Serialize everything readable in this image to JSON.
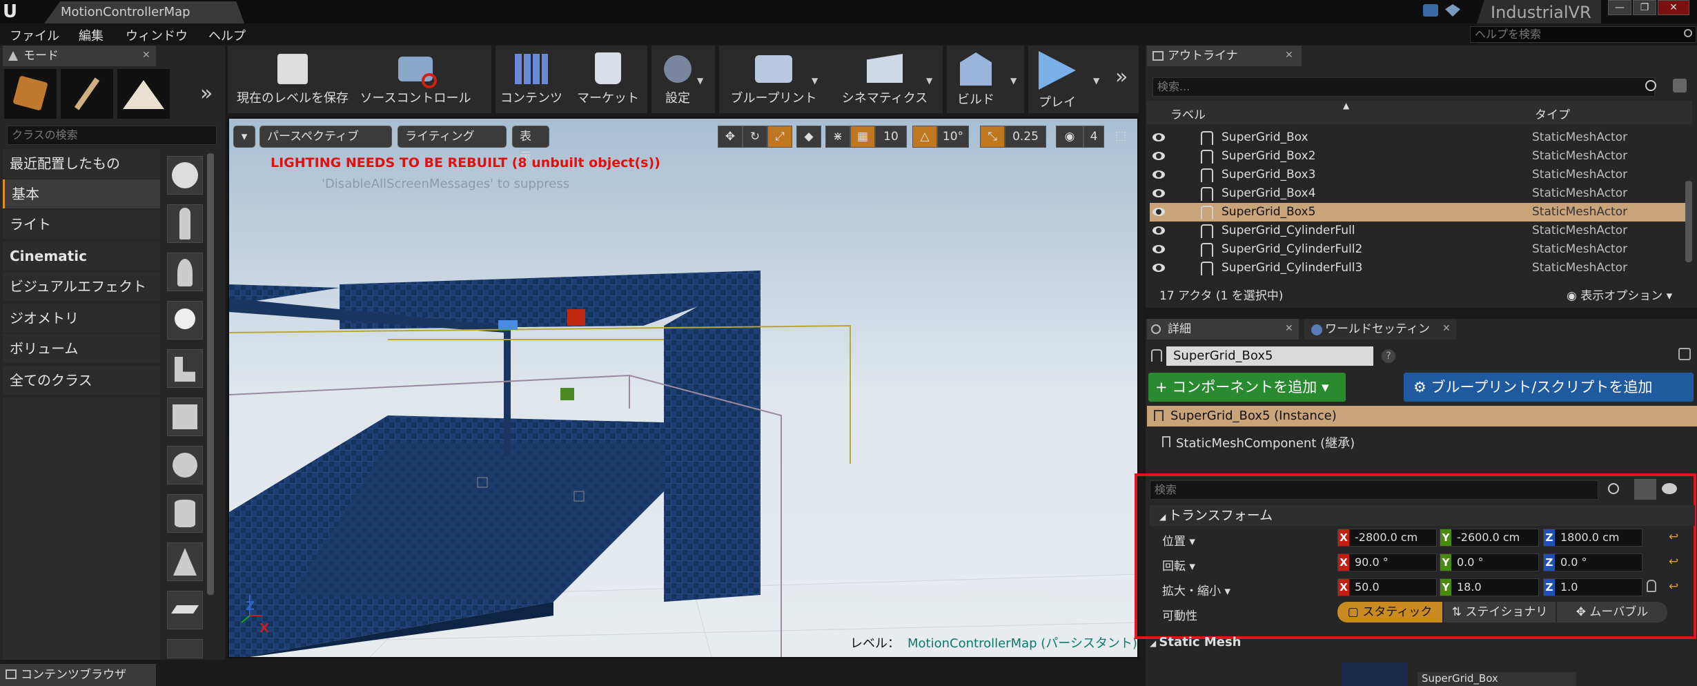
{
  "app": {
    "logo": "U",
    "tab_title": "MotionControllerMap",
    "project_name": "IndustrialVR",
    "help_search_placeholder": "ヘルプを検索",
    "window_buttons": {
      "minimize": "—",
      "maximize": "❐",
      "close": "✕"
    }
  },
  "menu": [
    "ファイル",
    "編集",
    "ウィンドウ",
    "ヘルプ"
  ],
  "modes": {
    "tab_label": "モード",
    "search_placeholder": "クラスの検索",
    "categories": [
      "最近配置したもの",
      "基本",
      "ライト",
      "Cinematic",
      "ビジュアルエフェクト",
      "ジオメトリ",
      "ボリューム",
      "全てのクラス"
    ],
    "selected_category": "基本",
    "expand": "»"
  },
  "toolbar": {
    "buttons": [
      "現在のレベルを保存",
      "ソースコントロール",
      "コンテンツ",
      "マーケット",
      "設定",
      "ブループリント",
      "シネマティクス",
      "ビルド",
      "プレイ"
    ],
    "expand": "»"
  },
  "viewport": {
    "perspective": "パースペクティブ",
    "lighting": "ライティング",
    "show": "表示",
    "grid_snap": "10",
    "rot_snap": "10°",
    "scale_snap": "0.25",
    "camera_speed": "4",
    "warning": "LIGHTING NEEDS TO BE REBUILT (8 unbuilt object(s))",
    "suppress_hint": "'DisableAllScreenMessages' to suppress",
    "level_label": "レベル：",
    "level_name": "MotionControllerMap (パーシスタント)",
    "axis_x": "X",
    "axis_z": "Z"
  },
  "outliner": {
    "tab_label": "アウトライナ",
    "search_placeholder": "検索...",
    "col_label": "ラベル",
    "col_type": "タイプ",
    "rows": [
      {
        "name": "SuperGrid_Box",
        "type": "StaticMeshActor"
      },
      {
        "name": "SuperGrid_Box2",
        "type": "StaticMeshActor"
      },
      {
        "name": "SuperGrid_Box3",
        "type": "StaticMeshActor"
      },
      {
        "name": "SuperGrid_Box4",
        "type": "StaticMeshActor"
      },
      {
        "name": "SuperGrid_Box5",
        "type": "StaticMeshActor"
      },
      {
        "name": "SuperGrid_CylinderFull",
        "type": "StaticMeshActor"
      },
      {
        "name": "SuperGrid_CylinderFull2",
        "type": "StaticMeshActor"
      },
      {
        "name": "SuperGrid_CylinderFull3",
        "type": "StaticMeshActor"
      }
    ],
    "selected_index": 4,
    "footer": "17 アクタ (1 を選択中)",
    "view_options": "表示オプション"
  },
  "details": {
    "tab_label": "詳細",
    "world_settings_tab": "ワールドセッティン",
    "actor_name": "SuperGrid_Box5",
    "add_component": "+ コンポーネントを追加",
    "add_blueprint": "ブループリント/スクリプトを追加",
    "instance_row": "SuperGrid_Box5 (Instance)",
    "component_row": "StaticMeshComponent (継承)",
    "search_placeholder": "検索",
    "transform_header": "トランスフォーム",
    "location": {
      "label": "位置",
      "x": "-2800.0 cm",
      "y": "-2600.0 cm",
      "z": "1800.0 cm"
    },
    "rotation": {
      "label": "回転",
      "x": "90.0 °",
      "y": "0.0 °",
      "z": "0.0 °"
    },
    "scale": {
      "label": "拡大・縮小",
      "x": "50.0",
      "y": "18.0",
      "z": "1.0"
    },
    "mobility": {
      "label": "可動性",
      "options": [
        "スタティック",
        "ステイショナリ",
        "ムーバブル"
      ],
      "selected": "スタティック"
    },
    "static_mesh_header": "Static Mesh",
    "mesh_name": "SuperGrid_Box"
  },
  "content_browser": {
    "tab_label": "コンテンツブラウザ"
  },
  "colors": {
    "accent": "#e09020",
    "selection": "#c9a47a",
    "add_component": "#2a8a30",
    "add_blueprint": "#1f5a9e",
    "highlight_box": "#e2141e"
  }
}
